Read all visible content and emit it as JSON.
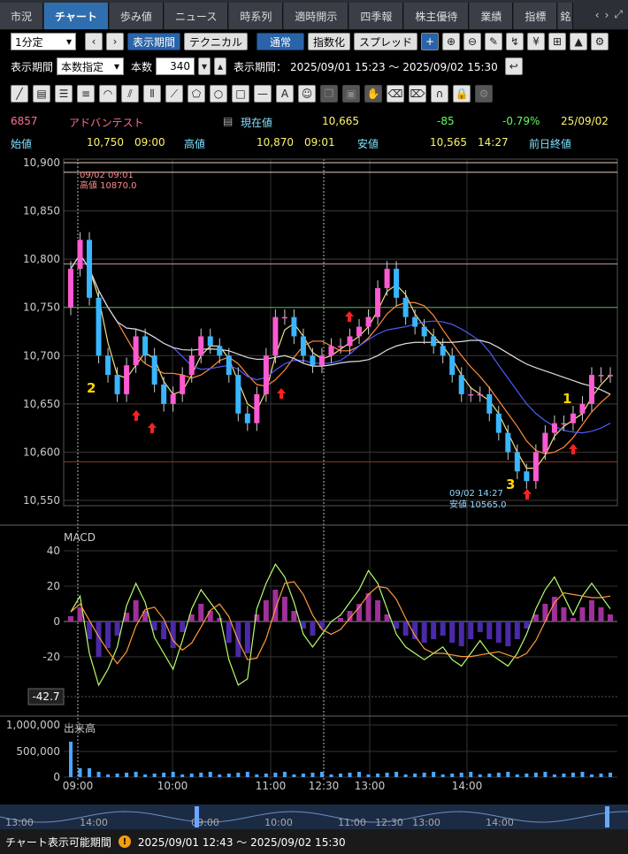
{
  "tabs": [
    "市況",
    "チャート",
    "歩み値",
    "ニュース",
    "時系列",
    "適時開示",
    "四季報",
    "株主優待",
    "業績",
    "指標",
    "銘"
  ],
  "active_tab": 1,
  "toolbar": {
    "interval": "1分定",
    "period_button": "表示期間",
    "technical_button": "テクニカル",
    "mode_normal": "通常",
    "mode_index": "指数化",
    "mode_spread": "スプレッド",
    "display_label": "表示期間",
    "display_select": "本数指定",
    "count_label": "本数",
    "count_value": "340",
    "range_label": "表示期間：",
    "range_value": "2025/09/01 15:23 ～ 2025/09/02 15:30"
  },
  "stock": {
    "code": "6857",
    "name": "アドバンテスト",
    "current_label": "現在値",
    "current_value": "10,665",
    "change": "-85",
    "change_pct": "-0.79%",
    "date": "25/09/02",
    "open_label": "始値",
    "open_value": "10,750",
    "open_time": "09:00",
    "high_label": "高値",
    "high_value": "10,870",
    "high_time": "09:01",
    "low_label": "安値",
    "low_value": "10,565",
    "low_time": "14:27",
    "prev_label": "前日終値"
  },
  "chart_data": {
    "type": "candlestick",
    "price_axis": {
      "ylim": [
        10525,
        10905
      ],
      "ticks": [
        10900,
        10850,
        10800,
        10750,
        10700,
        10650,
        10600,
        10550
      ],
      "tick_labels": [
        "10,900",
        "10,850",
        "10,800",
        "10,750",
        "10,700",
        "10,650",
        "10,600",
        "10,550"
      ]
    },
    "time_ticks": [
      "09:00",
      "10:00",
      "11:00",
      "12:30",
      "13:00",
      "14:00"
    ],
    "price_series": {
      "close": [
        10790,
        10820,
        10760,
        10700,
        10680,
        10660,
        10690,
        10720,
        10700,
        10670,
        10650,
        10660,
        10680,
        10700,
        10720,
        10710,
        10700,
        10680,
        10640,
        10630,
        10660,
        10700,
        10740,
        10740,
        10720,
        10700,
        10690,
        10700,
        10710,
        10710,
        10720,
        10730,
        10740,
        10770,
        10790,
        10760,
        10740,
        10730,
        10720,
        10710,
        10700,
        10680,
        10660,
        10660,
        10660,
        10640,
        10620,
        10600,
        10580,
        10570,
        10600,
        10620,
        10630,
        10630,
        10640,
        10650,
        10680,
        10680,
        10680
      ],
      "high_annotation": {
        "label1": "09/02 09:01",
        "label2": "高値 10870.0"
      },
      "low_annotation": {
        "label1": "09/02 14:27",
        "label2": "安値 10565.0"
      },
      "markers": [
        "2",
        "3",
        "1"
      ]
    },
    "macd": {
      "label": "MACD",
      "ylim": [
        -50,
        45
      ],
      "ticks": [
        40,
        20,
        0,
        -20
      ],
      "value_label": "-42.7",
      "hist": [
        3,
        8,
        -10,
        -20,
        -15,
        -8,
        5,
        12,
        6,
        -5,
        -10,
        -15,
        -6,
        4,
        10,
        6,
        2,
        -12,
        -20,
        -18,
        4,
        12,
        18,
        14,
        6,
        -4,
        -8,
        -4,
        0,
        2,
        6,
        10,
        16,
        12,
        4,
        -4,
        -8,
        -10,
        -12,
        -10,
        -8,
        -12,
        -14,
        -10,
        -6,
        -10,
        -12,
        -14,
        -10,
        -4,
        4,
        10,
        14,
        8,
        2,
        8,
        12,
        8,
        4
      ]
    },
    "volume": {
      "label": "出来高",
      "ticks": [
        "1,000,000",
        "500,000",
        "0"
      ]
    },
    "navigator_ticks": [
      "13:00",
      "14:00",
      "09:00",
      "10:00",
      "11:00",
      "12:30",
      "13:00",
      "14:00"
    ]
  },
  "footer": {
    "label": "チャート表示可能期間",
    "value": "2025/09/01 12:43 ～ 2025/09/02 15:30"
  }
}
